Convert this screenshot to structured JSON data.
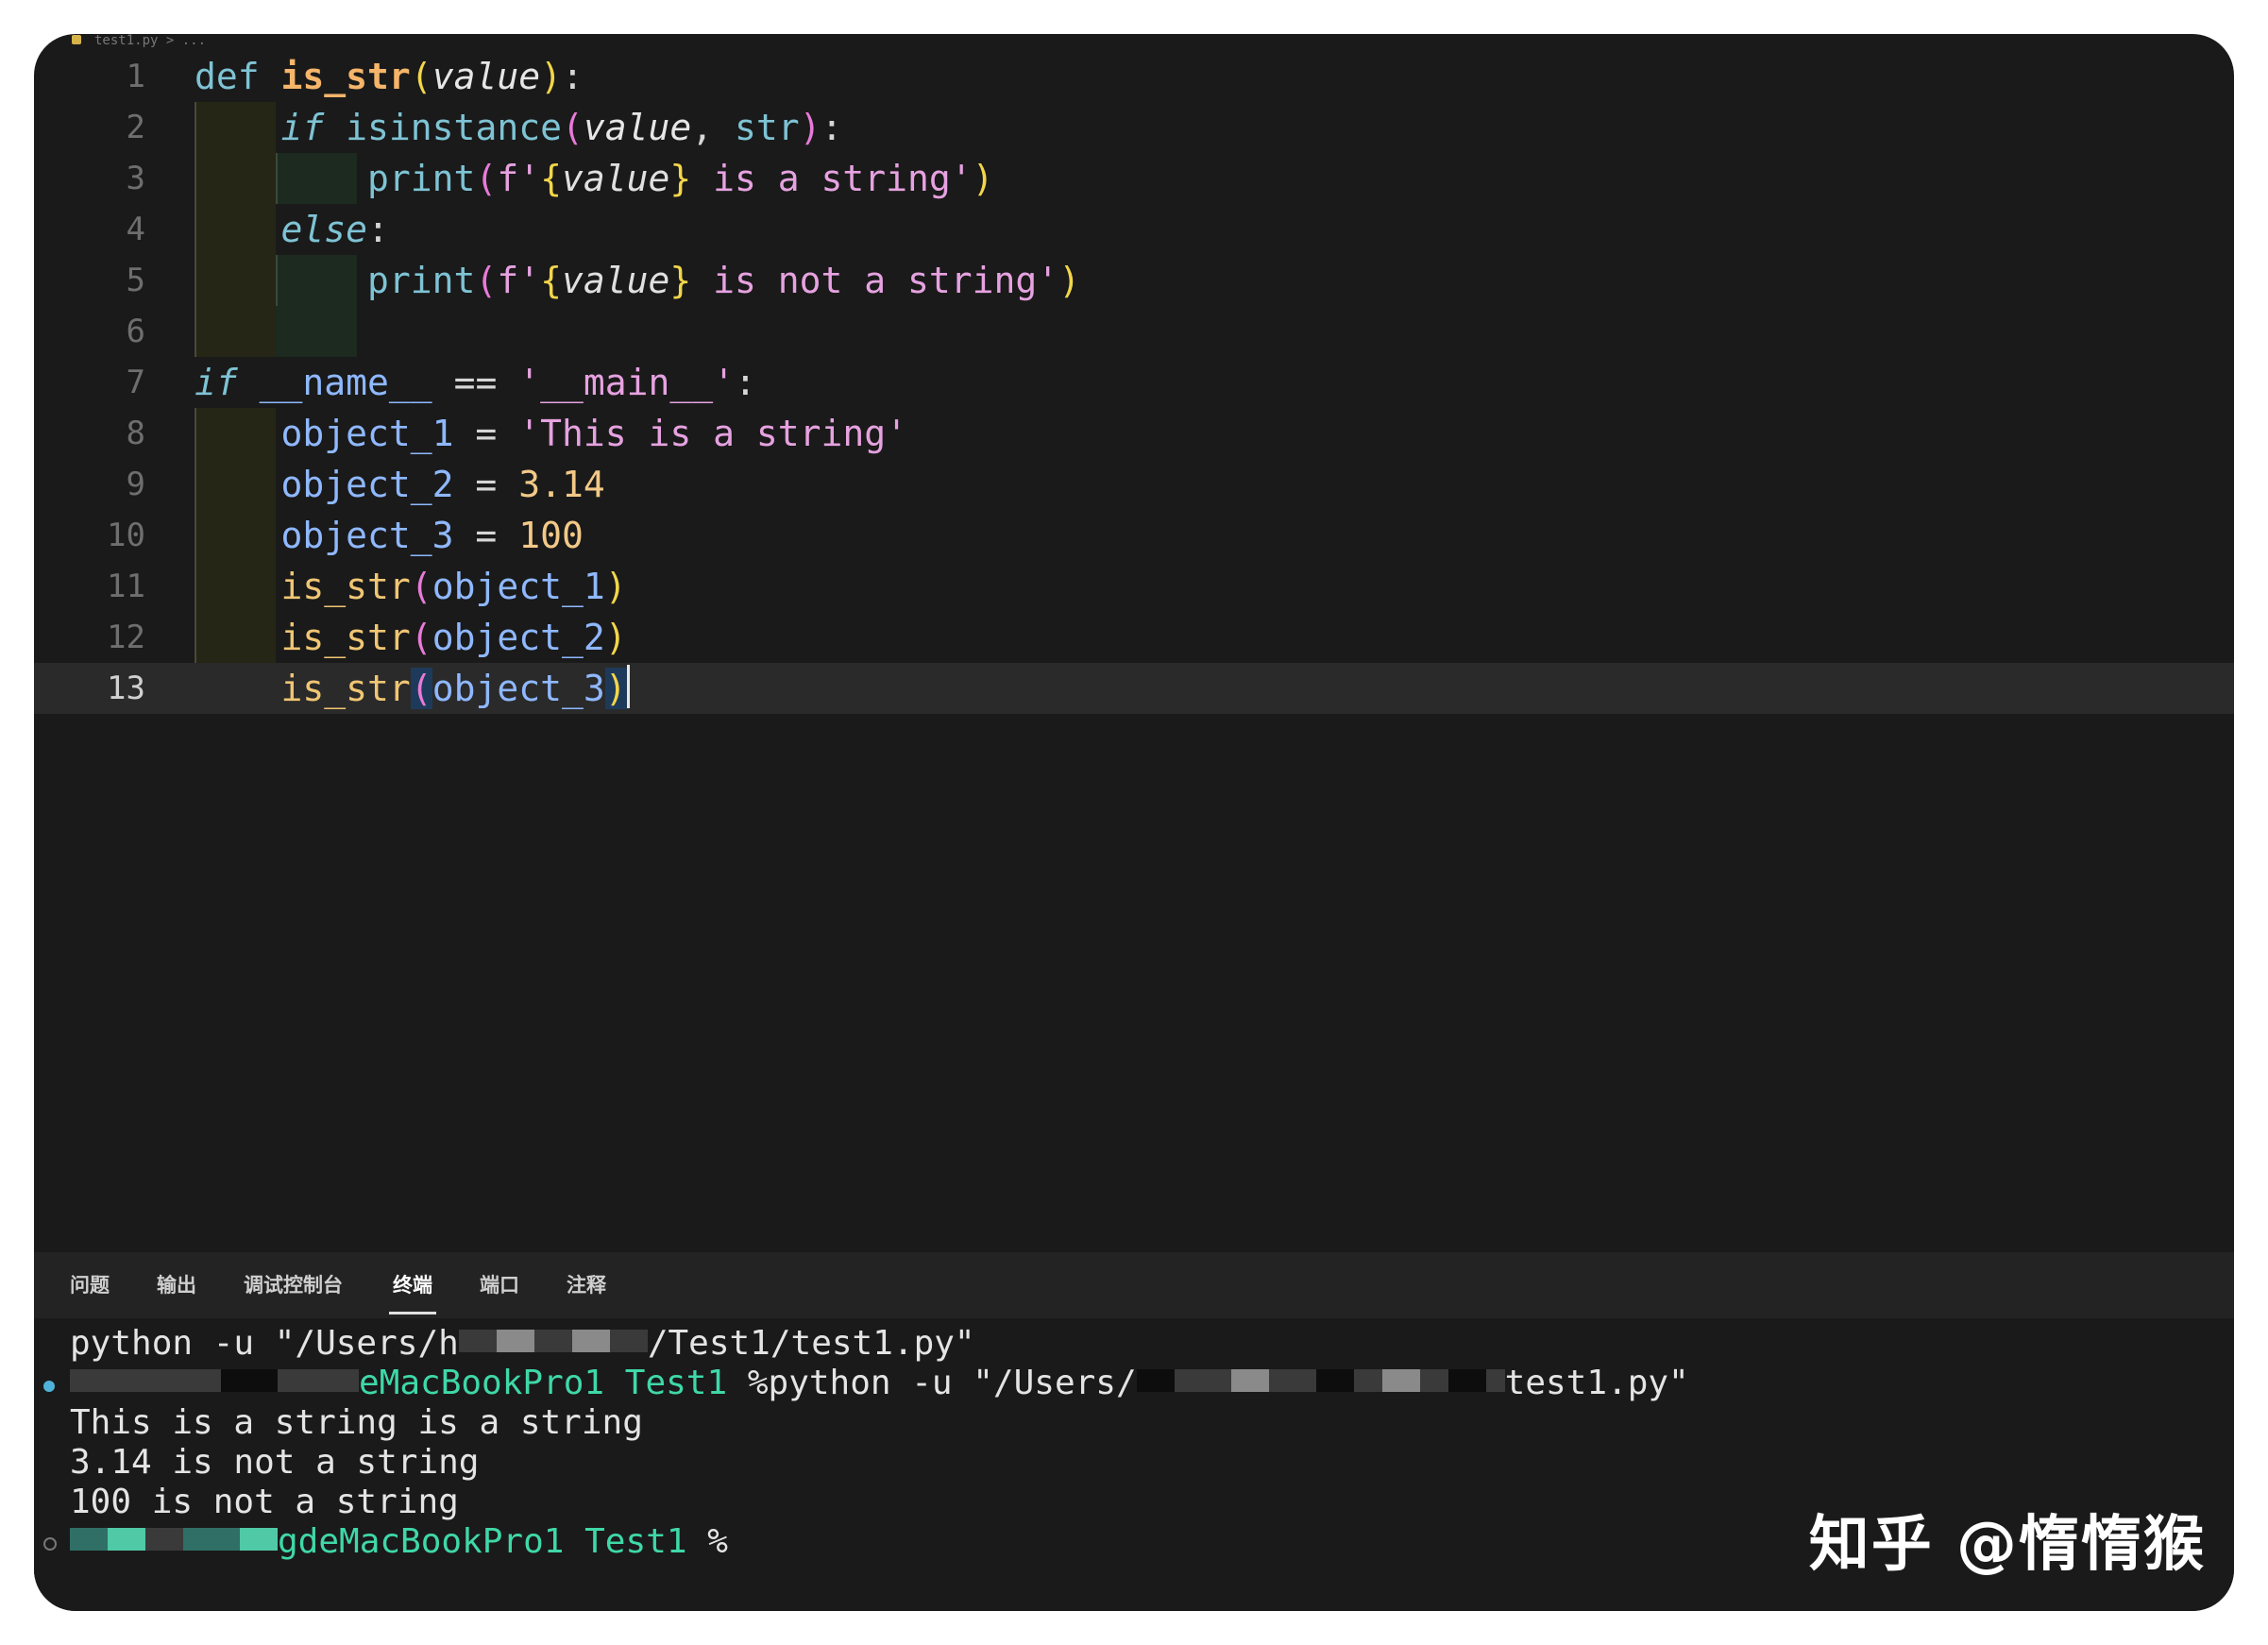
{
  "breadcrumb": "test1.py > ...",
  "editor": {
    "active_line": 13,
    "line_numbers": [
      "1",
      "2",
      "3",
      "4",
      "5",
      "6",
      "7",
      "8",
      "9",
      "10",
      "11",
      "12",
      "13"
    ],
    "lines": [
      [
        {
          "t": "def ",
          "c": "kw"
        },
        {
          "t": "is_str",
          "c": "fnb"
        },
        {
          "t": "(",
          "c": "paren"
        },
        {
          "t": "value",
          "c": "prm"
        },
        {
          "t": ")",
          "c": "paren"
        },
        {
          "t": ":",
          "c": "punc"
        }
      ],
      [
        {
          "t": "    "
        },
        {
          "t": "if",
          "c": "kwi"
        },
        {
          "t": " "
        },
        {
          "t": "isinstance",
          "c": "builtin"
        },
        {
          "t": "(",
          "c": "paren2"
        },
        {
          "t": "value",
          "c": "prm"
        },
        {
          "t": ", ",
          "c": "punc"
        },
        {
          "t": "str",
          "c": "builtin"
        },
        {
          "t": ")",
          "c": "paren2"
        },
        {
          "t": ":",
          "c": "punc"
        }
      ],
      [
        {
          "t": "        "
        },
        {
          "t": "print",
          "c": "builtin"
        },
        {
          "t": "(",
          "c": "paren2"
        },
        {
          "t": "f'",
          "c": "str"
        },
        {
          "t": "{",
          "c": "paren"
        },
        {
          "t": "value",
          "c": "strv"
        },
        {
          "t": "}",
          "c": "paren"
        },
        {
          "t": " is a string'",
          "c": "str"
        },
        {
          "t": ")",
          "c": "paren"
        }
      ],
      [
        {
          "t": "    "
        },
        {
          "t": "else",
          "c": "kwi"
        },
        {
          "t": ":",
          "c": "punc"
        }
      ],
      [
        {
          "t": "        "
        },
        {
          "t": "print",
          "c": "builtin"
        },
        {
          "t": "(",
          "c": "paren2"
        },
        {
          "t": "f'",
          "c": "str"
        },
        {
          "t": "{",
          "c": "paren"
        },
        {
          "t": "value",
          "c": "strv"
        },
        {
          "t": "}",
          "c": "paren"
        },
        {
          "t": " is not a string'",
          "c": "str"
        },
        {
          "t": ")",
          "c": "paren"
        }
      ],
      [],
      [
        {
          "t": "if",
          "c": "kwi"
        },
        {
          "t": " "
        },
        {
          "t": "__name__",
          "c": "dunder"
        },
        {
          "t": " == ",
          "c": "punc"
        },
        {
          "t": "'__main__'",
          "c": "str"
        },
        {
          "t": ":",
          "c": "punc"
        }
      ],
      [
        {
          "t": "    "
        },
        {
          "t": "object_1",
          "c": "var"
        },
        {
          "t": " = ",
          "c": "punc"
        },
        {
          "t": "'This is a string'",
          "c": "str"
        }
      ],
      [
        {
          "t": "    "
        },
        {
          "t": "object_2",
          "c": "var"
        },
        {
          "t": " = ",
          "c": "punc"
        },
        {
          "t": "3.14",
          "c": "num"
        }
      ],
      [
        {
          "t": "    "
        },
        {
          "t": "object_3",
          "c": "var"
        },
        {
          "t": " = ",
          "c": "punc"
        },
        {
          "t": "100",
          "c": "num"
        }
      ],
      [
        {
          "t": "    "
        },
        {
          "t": "is_str",
          "c": "fn"
        },
        {
          "t": "(",
          "c": "paren2"
        },
        {
          "t": "object_1",
          "c": "var"
        },
        {
          "t": ")",
          "c": "paren"
        }
      ],
      [
        {
          "t": "    "
        },
        {
          "t": "is_str",
          "c": "fn"
        },
        {
          "t": "(",
          "c": "paren2"
        },
        {
          "t": "object_2",
          "c": "var"
        },
        {
          "t": ")",
          "c": "paren"
        }
      ],
      [
        {
          "t": "    "
        },
        {
          "t": "is_str",
          "c": "fn"
        },
        {
          "t": "(",
          "c": "paren2 bracket-hl"
        },
        {
          "t": "object_3",
          "c": "var"
        },
        {
          "t": ")",
          "c": "paren bracket-hl"
        }
      ]
    ]
  },
  "panel": {
    "tabs": [
      {
        "label": "问题",
        "active": false
      },
      {
        "label": "输出",
        "active": false
      },
      {
        "label": "调试控制台",
        "active": false
      },
      {
        "label": "终端",
        "active": true
      },
      {
        "label": "端口",
        "active": false
      },
      {
        "label": "注释",
        "active": false
      }
    ],
    "terminal": {
      "cmd1_a": "python -u \"/Users/h",
      "cmd1_b": "/Test1/test1.py\"",
      "prompt_host": "eMacBookPro1",
      "prompt_dir": "Test1",
      "cmd2_a": "%python -u \"/Users/",
      "cmd2_b": "test1.py\"",
      "out1": "This is a string is a string",
      "out2": "3.14 is not a string",
      "out3": "100 is not a string",
      "prompt2_host": "gdeMacBookPro1",
      "prompt2_dir": "Test1",
      "prompt2_sym": "%"
    }
  },
  "watermark": "知乎 @惰惰猴"
}
